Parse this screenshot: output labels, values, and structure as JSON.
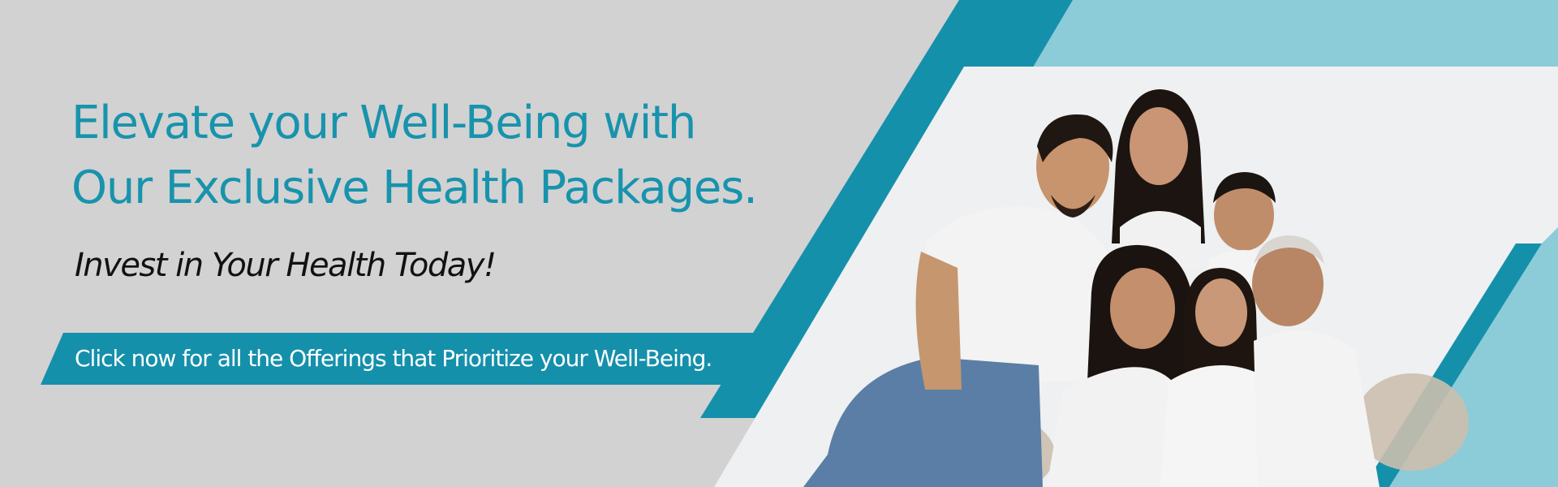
{
  "banner": {
    "headline_line1": "Elevate your Well-Being with",
    "headline_line2": "Our Exclusive Health Packages.",
    "subheadline": "Invest in Your Health Today!",
    "cta_label": "Click now for all the Offerings that Prioritize your Well-Being.",
    "photo_subject": "family-group-photo"
  },
  "colors": {
    "background": "#d2d2d2",
    "accent_teal": "#1590ab",
    "light_teal": "#8ccbd8",
    "headline": "#1893ad",
    "photo_backdrop": "#eef0f1"
  }
}
